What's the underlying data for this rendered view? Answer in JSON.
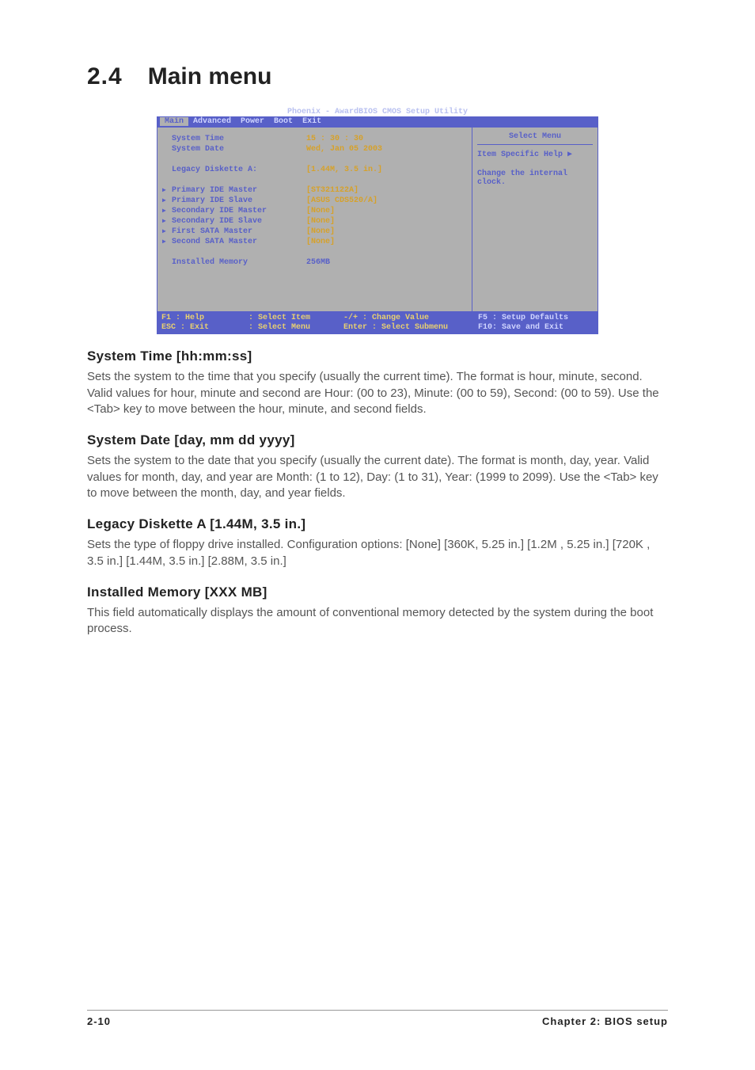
{
  "heading": {
    "number": "2.4",
    "title": "Main menu"
  },
  "bios": {
    "utility_title": "Phoenix - AwardBIOS CMOS Setup Utility",
    "tabs": {
      "main": "Main",
      "advanced": "Advanced",
      "power": "Power",
      "boot": "Boot",
      "exit": "Exit"
    },
    "fields": {
      "system_time": {
        "label": "System Time",
        "value": "15 : 30 : 30"
      },
      "system_date": {
        "label": "System Date",
        "value": "Wed, Jan 05 2003"
      },
      "legacy_diskette": {
        "label": "Legacy Diskette A:",
        "value": "[1.44M, 3.5 in.]"
      },
      "primary_master": {
        "label": "Primary IDE Master",
        "value": "[ST321122A]"
      },
      "primary_slave": {
        "label": "Primary IDE Slave",
        "value": "[ASUS CDS520/A]"
      },
      "secondary_master": {
        "label": "Secondary IDE Master",
        "value": "[None]"
      },
      "secondary_slave": {
        "label": "Secondary IDE Slave",
        "value": "[None]"
      },
      "first_sata": {
        "label": "First SATA Master",
        "value": "[None]"
      },
      "second_sata": {
        "label": "Second SATA Master",
        "value": "[None]"
      },
      "installed_memory": {
        "label": "Installed Memory",
        "value": "256MB"
      }
    },
    "help_panel": {
      "title": "Select Menu",
      "sub": "Item Specific Help ▶",
      "text": "Change the internal clock."
    },
    "footer": {
      "line1_a": "F1  : Help",
      "line1_b": ": Select Item",
      "line1_c": "-/+   : Change Value",
      "line1_d": "F5 : Setup Defaults",
      "line2_a": "ESC : Exit",
      "line2_b": ": Select Menu",
      "line2_c": "Enter : Select Submenu",
      "line2_d": "F10: Save and Exit"
    }
  },
  "sections": {
    "system_time": {
      "title": "System Time [hh:mm:ss]",
      "body": "Sets the system to the time that you specify (usually the current time). The format is hour, minute, second. Valid values for hour, minute and second are Hour: (00 to 23), Minute: (00 to 59), Second: (00 to 59). Use the <Tab> key to move between the hour, minute, and second fields."
    },
    "system_date": {
      "title": "System Date [day, mm dd yyyy]",
      "body": "Sets the system to the date that you specify (usually the current date). The format is month, day, year. Valid values for month, day, and year are Month: (1 to 12), Day: (1 to 31), Year: (1999 to 2099). Use the <Tab> key to move between the month, day, and year fields."
    },
    "legacy_diskette": {
      "title": "Legacy Diskette A [1.44M, 3.5 in.]",
      "body": "Sets the type of floppy drive installed. Configuration options: [None] [360K, 5.25 in.] [1.2M , 5.25 in.] [720K , 3.5 in.] [1.44M, 3.5 in.] [2.88M, 3.5 in.]"
    },
    "installed_memory": {
      "title": "Installed Memory [XXX MB]",
      "body": "This field automatically displays the amount of conventional memory detected by the system during the boot process."
    }
  },
  "page_footer": {
    "left": "2-10",
    "right": "Chapter 2: BIOS setup"
  }
}
